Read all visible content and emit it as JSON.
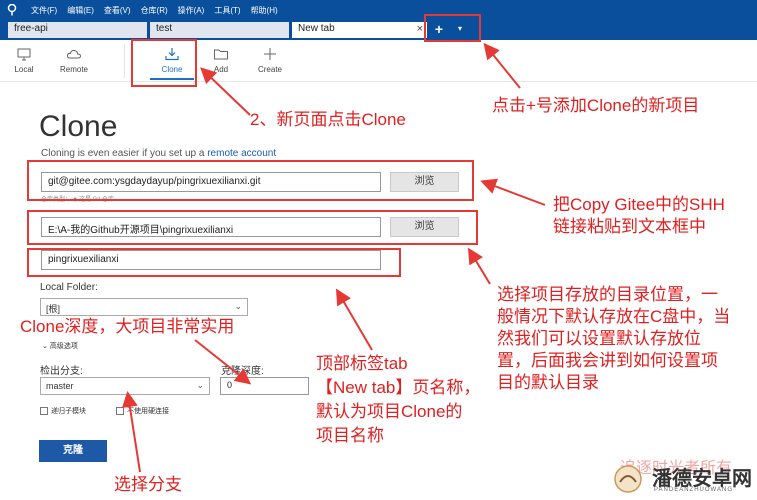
{
  "menu": [
    "文件(F)",
    "编辑(E)",
    "查看(V)",
    "仓库(R)",
    "操作(A)",
    "工具(T)",
    "帮助(H)"
  ],
  "tabs": [
    {
      "label": "free-api"
    },
    {
      "label": "test"
    },
    {
      "label": "New tab",
      "close": "×"
    }
  ],
  "new_tab_button": "+",
  "new_tab_dropdown": "▾",
  "toolbar": {
    "local": "Local",
    "remote": "Remote",
    "clone": "Clone",
    "add": "Add",
    "create": "Create"
  },
  "clone_page": {
    "title": "Clone",
    "subtitle_prefix": "Cloning is even easier if you set up a ",
    "subtitle_link": "remote account",
    "source_url": "git@gitee.com:ysgdaydayup/pingrixuexilianxi.git",
    "browse": "浏览",
    "repo_type_hint": "仓库类型：",
    "repo_type_value": "◆ 这是 Git 仓库",
    "destination_path": "E:\\A-我的Github开源项目\\pingrixuexilianxi",
    "name": "pingrixuexilianxi",
    "local_folder_label": "Local Folder:",
    "local_folder_value": "[根]",
    "advanced": "高级选项",
    "branch_label": "检出分支:",
    "branch_value": "master",
    "depth_label": "克隆深度:",
    "depth_value": "0",
    "recurse_submodules": "递归子模块",
    "hardlinks": "不使用硬连接",
    "clone_button": "克隆"
  },
  "annotations": {
    "step_new_tab": "点击+号添加Clone的新项目",
    "step_click_clone": "2、新页面点击Clone",
    "paste_ssh_1": "把Copy Gitee中的SHH",
    "paste_ssh_2": "链接粘贴到文本框中",
    "dir_1": "选择项目存放的目录位置，一",
    "dir_2": "般情况下默认存放在C盘中，当",
    "dir_3": "然我们可以设置默认存放位",
    "dir_4": "置，后面我会讲到如何设置项",
    "dir_5": "目的默认目录",
    "depth_note": "Clone深度，大项目非常实用",
    "tab_name_1": "顶部标签tab",
    "tab_name_2": "【New tab】页名称，",
    "tab_name_3": "默认为项目Clone的",
    "tab_name_4": "项目名称",
    "branch_note": "选择分支",
    "watermark": "追逐时光者所有",
    "brand": "潘德安卓网",
    "brand_sub": "PANDEANZHUOWANG"
  },
  "colors": {
    "brand_blue": "#0a4f9c",
    "accent": "#1e6fc7",
    "annotation_red": "#e53935"
  }
}
